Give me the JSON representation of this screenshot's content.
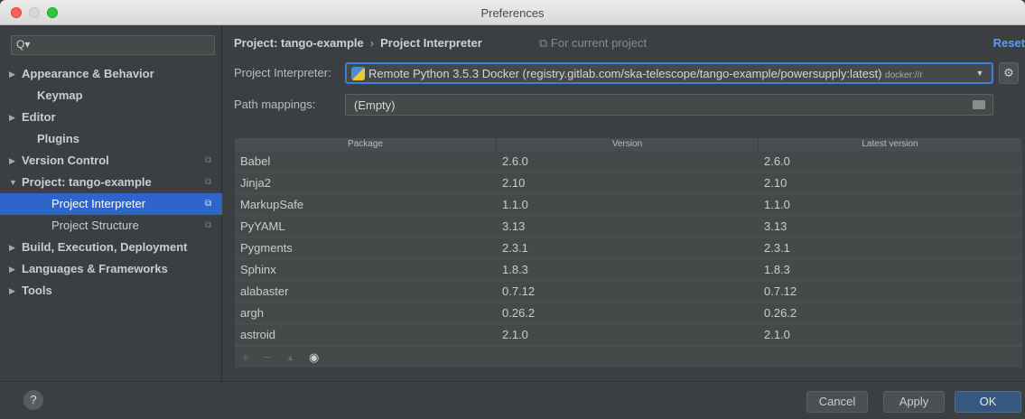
{
  "window": {
    "title": "Preferences"
  },
  "sidebar": {
    "search_placeholder": "",
    "items": [
      {
        "label": "Appearance & Behavior",
        "expandable": true,
        "arrow": "▶"
      },
      {
        "label": "Keymap",
        "expandable": false
      },
      {
        "label": "Editor",
        "expandable": true,
        "arrow": "▶"
      },
      {
        "label": "Plugins",
        "expandable": false
      },
      {
        "label": "Version Control",
        "expandable": true,
        "arrow": "▶"
      },
      {
        "label": "Project: tango-example",
        "expandable": true,
        "arrow": "▼"
      },
      {
        "label": "Project Interpreter",
        "child": true,
        "selected": true
      },
      {
        "label": "Project Structure",
        "child": true
      },
      {
        "label": "Build, Execution, Deployment",
        "expandable": true,
        "arrow": "▶"
      },
      {
        "label": "Languages & Frameworks",
        "expandable": true,
        "arrow": "▶"
      },
      {
        "label": "Tools",
        "expandable": true,
        "arrow": "▶"
      }
    ]
  },
  "header": {
    "breadcrumb_parent": "Project: tango-example",
    "breadcrumb_sep": "›",
    "breadcrumb_current": "Project Interpreter",
    "scope_note": "⧉ For current project",
    "reset_label": "Reset"
  },
  "interpreter": {
    "label": "Project Interpreter:",
    "value": "Remote Python 3.5.3 Docker (registry.gitlab.com/ska-telescope/tango-example/powersupply:latest)",
    "suffix": "docker://r"
  },
  "path_mappings": {
    "label": "Path mappings:",
    "value": "(Empty)"
  },
  "packages": {
    "columns": [
      "Package",
      "Version",
      "Latest version"
    ],
    "rows": [
      [
        "Babel",
        "2.6.0",
        "2.6.0"
      ],
      [
        "Jinja2",
        "2.10",
        "2.10"
      ],
      [
        "MarkupSafe",
        "1.1.0",
        "1.1.0"
      ],
      [
        "PyYAML",
        "3.13",
        "3.13"
      ],
      [
        "Pygments",
        "2.3.1",
        "2.3.1"
      ],
      [
        "Sphinx",
        "1.8.3",
        "1.8.3"
      ],
      [
        "alabaster",
        "0.7.12",
        "0.7.12"
      ],
      [
        "argh",
        "0.26.2",
        "0.26.2"
      ],
      [
        "astroid",
        "2.1.0",
        "2.1.0"
      ]
    ]
  },
  "toolbar": {
    "add": "+",
    "remove": "−",
    "up": "▲",
    "show": "◉"
  },
  "footer": {
    "help_label": "?",
    "cancel_label": "Cancel",
    "apply_label": "Apply",
    "ok_label": "OK"
  },
  "colors": {
    "accent": "#2f65ca",
    "link": "#589df6",
    "background": "#3c3f41"
  }
}
